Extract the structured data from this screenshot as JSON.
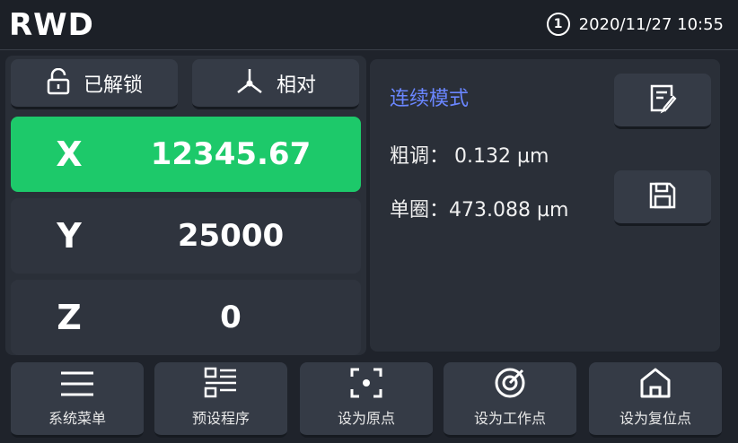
{
  "header": {
    "logo": "RWD",
    "badge": "1",
    "datetime": "2020/11/27 10:55"
  },
  "controls": {
    "lock_label": "已解锁",
    "coord_mode_label": "相对"
  },
  "axes": [
    {
      "name": "X",
      "value": "12345.67",
      "active": true
    },
    {
      "name": "Y",
      "value": "25000",
      "active": false
    },
    {
      "name": "Z",
      "value": "0",
      "active": false
    }
  ],
  "mode_panel": {
    "title": "连续模式",
    "coarse_label": "粗调：",
    "coarse_value": "0.132 µm",
    "turn_label": "单圈：",
    "turn_value": "473.088 µm"
  },
  "bottom_menu": [
    {
      "label": "系统菜单",
      "icon": "menu-icon"
    },
    {
      "label": "预设程序",
      "icon": "list-icon"
    },
    {
      "label": "设为原点",
      "icon": "focus-icon"
    },
    {
      "label": "设为工作点",
      "icon": "target-icon"
    },
    {
      "label": "设为复位点",
      "icon": "home-icon"
    }
  ],
  "colors": {
    "accent_green": "#1dc96a",
    "mode_blue": "#6a86ff",
    "background": "#1f232b"
  }
}
